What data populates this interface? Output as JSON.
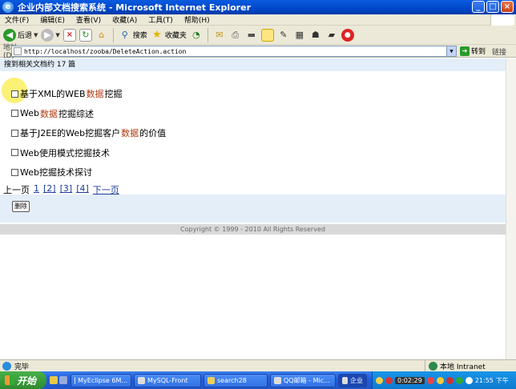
{
  "window": {
    "title": "企业内部文档搜索系统 - Microsoft Internet Explorer",
    "buttons": {
      "minimize": "_",
      "maximize": "□",
      "close": "×"
    }
  },
  "menu": [
    "文件(F)",
    "编辑(E)",
    "查看(V)",
    "收藏(A)",
    "工具(T)",
    "帮助(H)"
  ],
  "toolbar": {
    "back_label": "后退",
    "search_label": "搜索",
    "favorites_label": "收藏夹"
  },
  "address": {
    "label": "地址(D)",
    "url": "http://localhost/zooba/DeleteAction.action",
    "go_label": "转到",
    "links_label": "链接"
  },
  "page": {
    "result_text": "搜到相关文档约 17 篇",
    "documents": [
      {
        "pre": "基于XML的WEB",
        "hl": "数据",
        "post": "挖掘"
      },
      {
        "pre": "Web",
        "hl": "数据",
        "post": "挖掘综述"
      },
      {
        "pre": "基于J2EE的Web挖掘客户",
        "hl": "数据",
        "post": "的价值"
      },
      {
        "pre": "Web使用模式挖掘技术",
        "hl": "",
        "post": ""
      },
      {
        "pre": "Web挖掘技术探讨",
        "hl": "",
        "post": ""
      }
    ],
    "pager": {
      "prev": "上一页",
      "pages": [
        "1",
        "[2]",
        "[3]",
        "[4]"
      ],
      "next": "下一页"
    },
    "delete_label": "删除",
    "copyright": "Copyright © 1999 - 2010 All Rights Reserved",
    "highlight_color": "#b23a12"
  },
  "status": {
    "text": "完毕",
    "zone": "本地 Intranet"
  },
  "taskbar": {
    "start": "开始",
    "tasks": [
      "MyEclipse 6M...",
      "MySQL-Front",
      "search28",
      "QQ邮箱 - Mic...",
      "企业"
    ],
    "clock": "21:55",
    "period": "下午",
    "recording": "0:02:29"
  }
}
